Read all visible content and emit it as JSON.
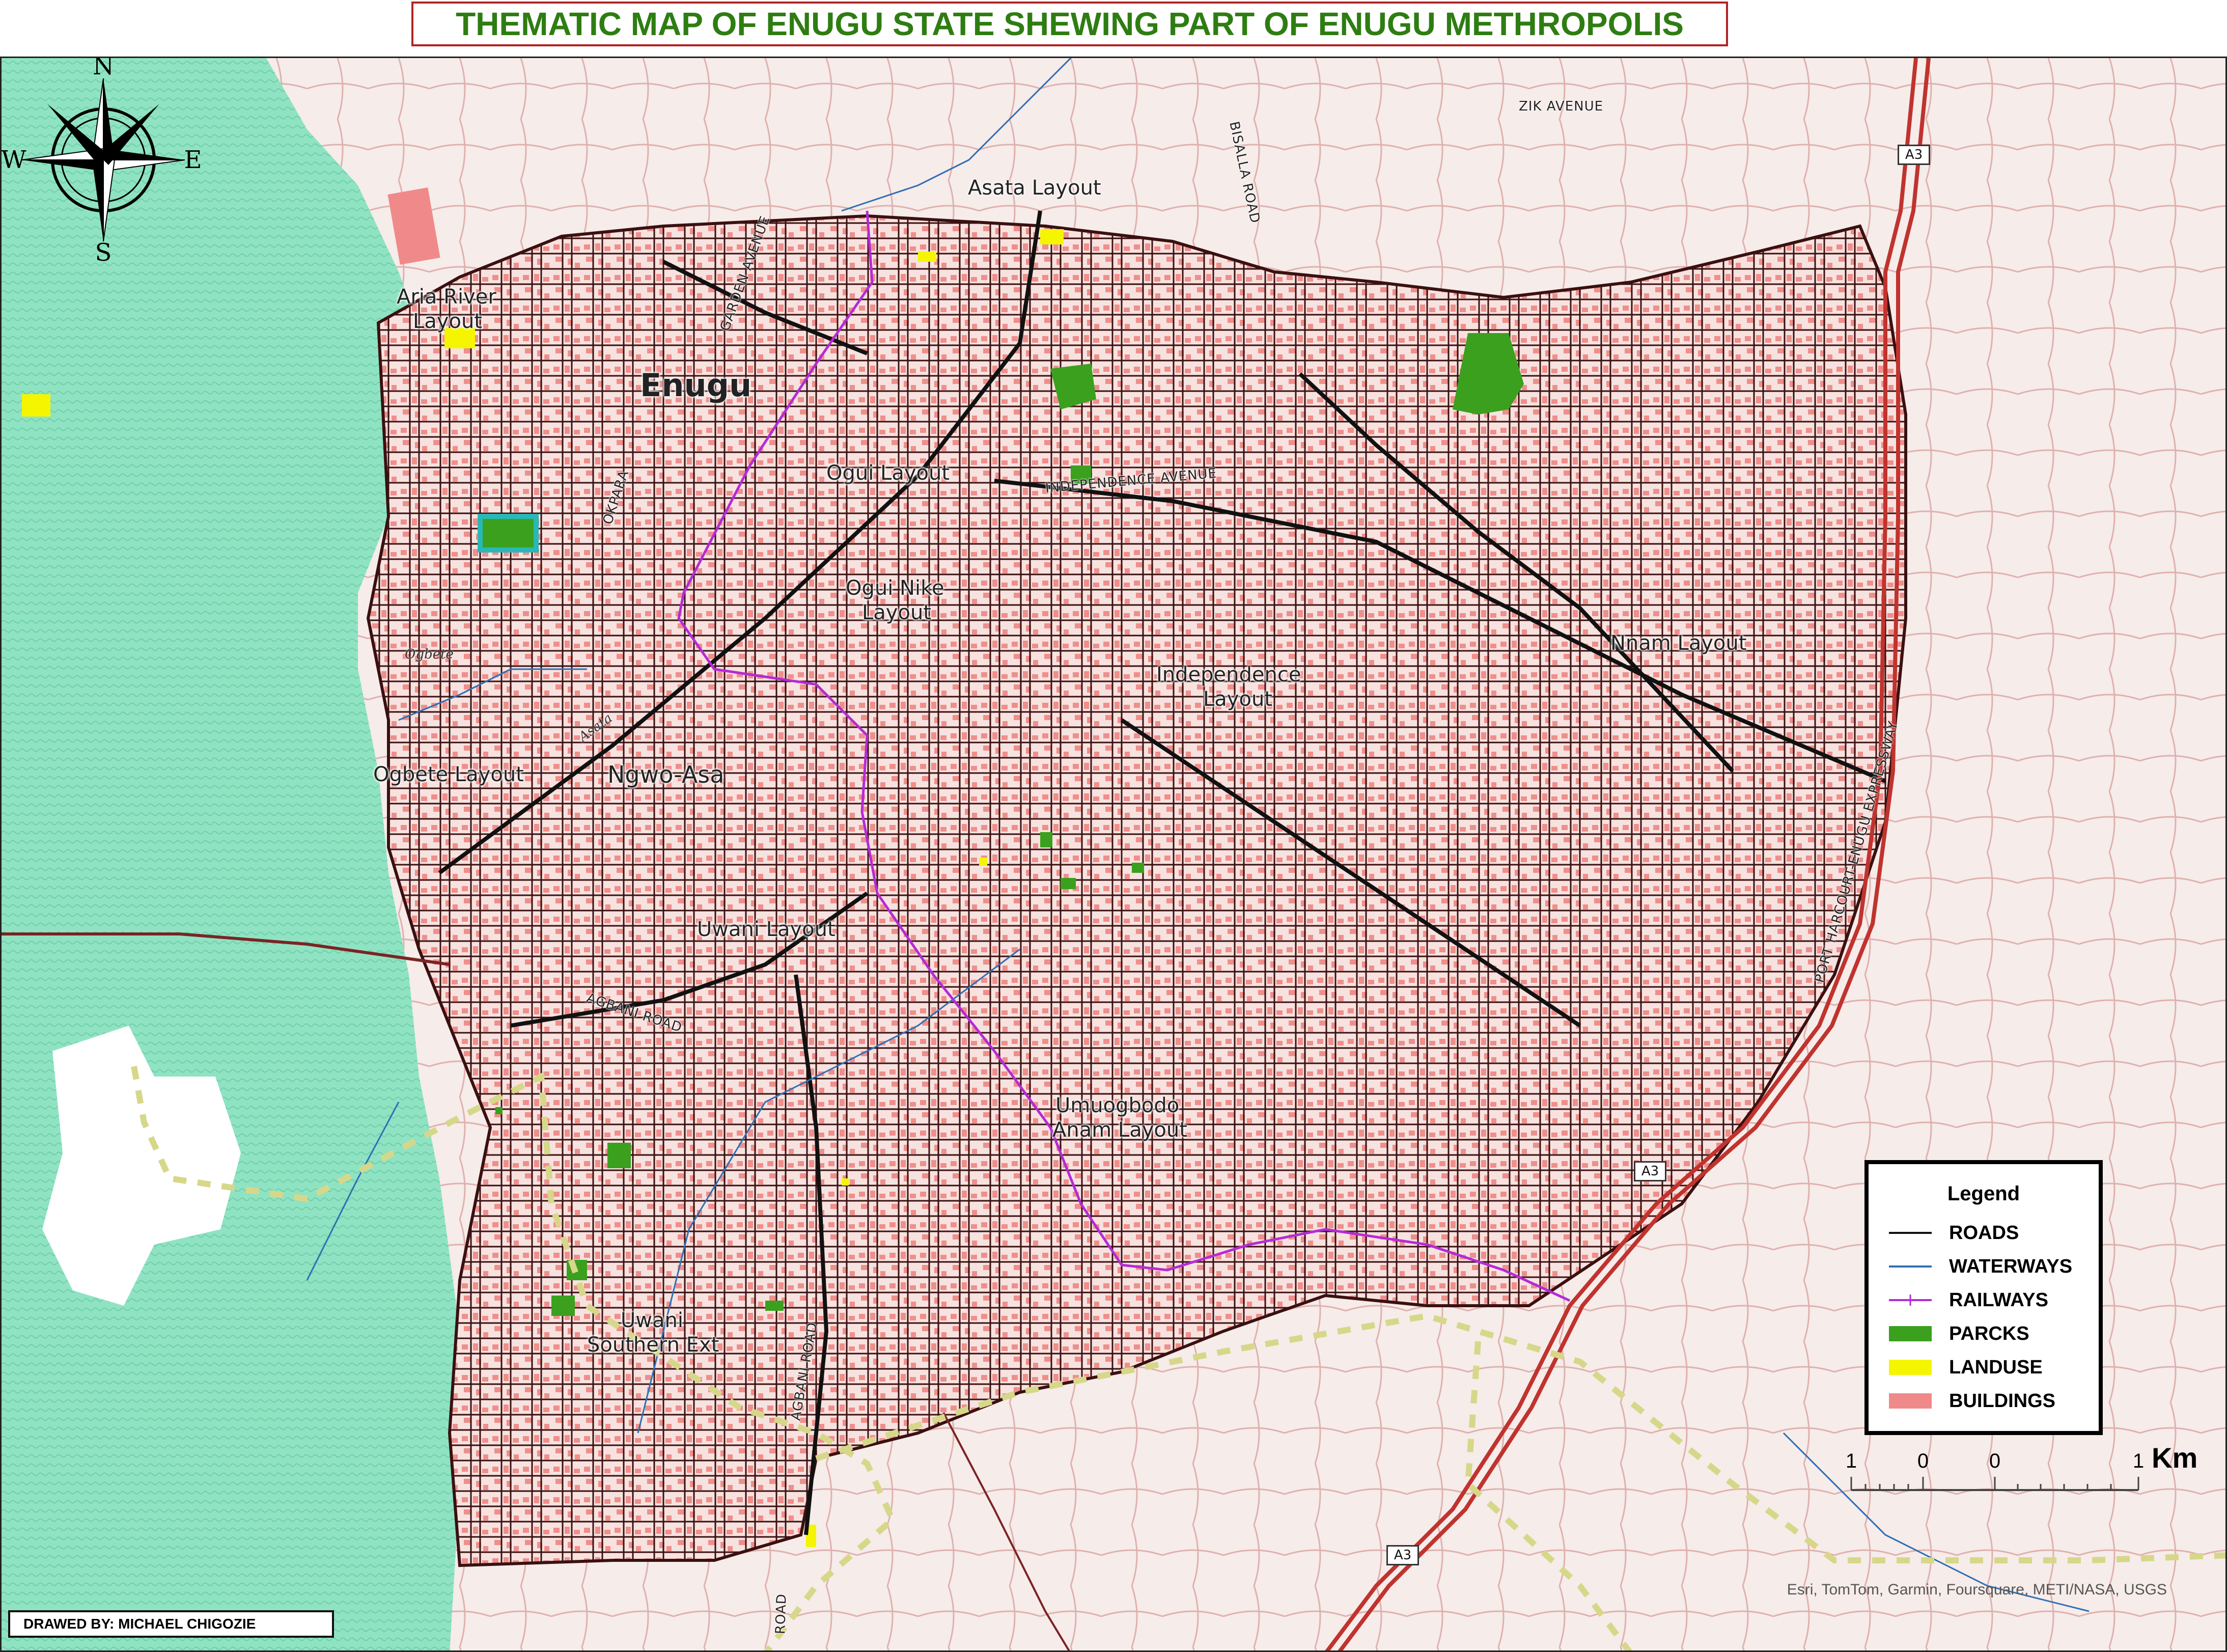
{
  "title": "THEMATIC MAP OF ENUGU STATE SHEWING PART OF ENUGU METHROPOLIS",
  "place_labels": {
    "enugu": "Enugu",
    "aria_river_1": "Aria River",
    "aria_river_2": "Layout",
    "asata": "Asata Layout",
    "ogui": "Ogui Layout",
    "ogui_nike_1": "Ogui Nike",
    "ogui_nike_2": "Layout",
    "independence_1": "Independence",
    "independence_2": "Layout",
    "nnam": "Nnam Layout",
    "ogbete_layout": "Ogbete Layout",
    "ngwo_asa": "Ngwo-Asa",
    "uwani": "Uwani Layout",
    "umuogbodo_1": "Umuogbodo",
    "umuogbodo_2": "Anam Layout",
    "uwani_southern_1": "Uwani",
    "uwani_southern_2": "Southern Ext"
  },
  "road_labels": {
    "garden_avenue": "GARDEN AVENUE",
    "bisalla_road": "BISALLA ROAD",
    "okpara": "OKPARA",
    "independence_avenue": "INDEPENDENCE AVENUE",
    "agbani_road_1": "AGBANI ROAD",
    "agbani_road_2": "AGBANI ROAD",
    "expressway": "PORT HARCOURT-ENUGU EXPRESSWAY",
    "top_avenue": "ZIK AVENUE",
    "road_bottom": "ROAD"
  },
  "water_labels": {
    "ogbete": "Ogbete",
    "asata": "Asata"
  },
  "shields": {
    "a3_top": "A3",
    "a3_mid": "A3",
    "a3_bottom": "A3"
  },
  "compass": {
    "n": "N",
    "s": "S",
    "e": "E",
    "w": "W"
  },
  "legend": {
    "title": "Legend",
    "items": [
      {
        "label": "ROADS",
        "color": "#111111",
        "kind": "line"
      },
      {
        "label": "WATERWAYS",
        "color": "#2f6fb5",
        "kind": "line"
      },
      {
        "label": "RAILWAYS",
        "color": "#b52ad6",
        "kind": "rail"
      },
      {
        "label": "PARCKS",
        "color": "#3aa01e",
        "kind": "fill"
      },
      {
        "label": "LANDUSE",
        "color": "#f5f500",
        "kind": "fill"
      },
      {
        "label": "BUILDINGS",
        "color": "#f08a8a",
        "kind": "fill"
      }
    ]
  },
  "scale": {
    "ticks": [
      "1",
      "0",
      "0",
      "1"
    ],
    "unit": "Km"
  },
  "credit": "Esri, TomTom, Garmin, Foursquare, METI/NASA, USGS",
  "author": "DRAWED BY: MICHAEL CHIGOZIE",
  "colors": {
    "forest": "#8fe3c3",
    "background": "#f6ecea",
    "highway": "#c0332e",
    "boundary": "#d7d78a",
    "title_text": "#2e7d12",
    "title_border": "#b22222"
  }
}
